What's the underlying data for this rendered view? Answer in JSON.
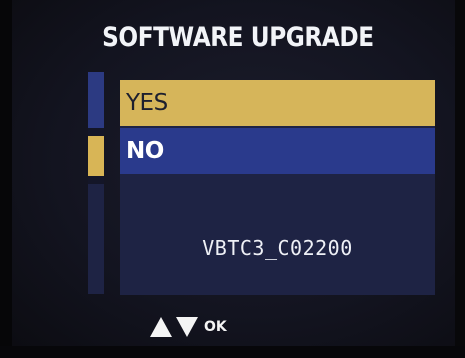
{
  "title": "SOFTWARE UPGRADE",
  "options": [
    {
      "label": "YES",
      "selected": true
    },
    {
      "label": "NO",
      "selected": false
    }
  ],
  "version": "VBTC3_C02200",
  "hint": {
    "icons": [
      "up-arrow-icon",
      "down-arrow-icon"
    ],
    "label": "OK"
  },
  "colors": {
    "highlight": "#d6b55a",
    "option_bg": "#2a3a8c",
    "panel_bg": "#1e2344",
    "text": "#ffffff"
  }
}
